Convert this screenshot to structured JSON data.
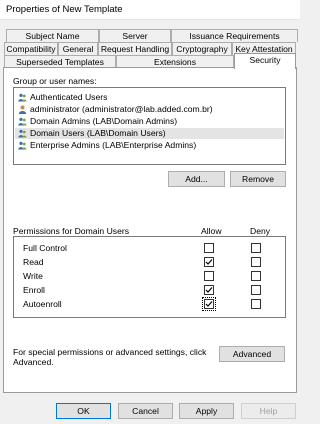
{
  "window": {
    "title": "Properties of New Template"
  },
  "tabs_row1": [
    "Subject Name",
    "Server",
    "Issuance Requirements"
  ],
  "tabs_row2": [
    "Compatibility",
    "General",
    "Request Handling",
    "Cryptography",
    "Key Attestation"
  ],
  "tabs_row3": [
    "Superseded Templates",
    "Extensions",
    "Security"
  ],
  "active_tab": "Security",
  "security": {
    "group_label": "Group or user names:",
    "users": [
      {
        "name": "Authenticated Users",
        "icon": "users-group-icon",
        "selected": false
      },
      {
        "name": "administrator (administrator@lab.added.com.br)",
        "icon": "user-icon",
        "selected": false
      },
      {
        "name": "Domain Admins (LAB\\Domain Admins)",
        "icon": "users-group-icon",
        "selected": false
      },
      {
        "name": "Domain Users (LAB\\Domain Users)",
        "icon": "users-group-icon",
        "selected": true
      },
      {
        "name": "Enterprise Admins (LAB\\Enterprise Admins)",
        "icon": "users-group-icon",
        "selected": false
      }
    ],
    "add_label": "Add...",
    "remove_label": "Remove",
    "permissions_label": "Permissions for Domain Users",
    "allow_label": "Allow",
    "deny_label": "Deny",
    "permissions": [
      {
        "name": "Full Control",
        "allow": false,
        "deny": false
      },
      {
        "name": "Read",
        "allow": true,
        "deny": false
      },
      {
        "name": "Write",
        "allow": false,
        "deny": false
      },
      {
        "name": "Enroll",
        "allow": true,
        "deny": false
      },
      {
        "name": "Autoenroll",
        "allow": true,
        "deny": false
      }
    ],
    "advanced_text_line1": "For special permissions or advanced settings, click",
    "advanced_text_line2": "Advanced.",
    "advanced_label": "Advanced"
  },
  "buttons": {
    "ok": "OK",
    "cancel": "Cancel",
    "apply": "Apply",
    "help": "Help"
  },
  "colors": {
    "focus_border": "#0078d7",
    "selected_row": "#e4e4e4"
  }
}
